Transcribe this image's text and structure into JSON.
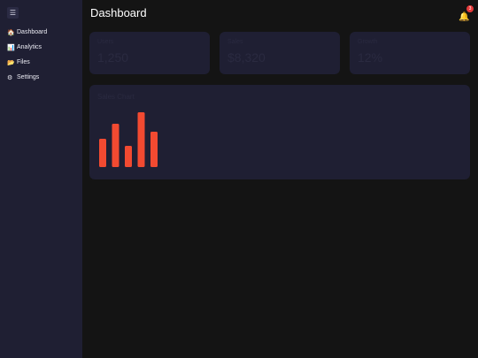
{
  "header": {
    "title": "Dashboard"
  },
  "sidebar": {
    "menu_icon": "hamburger-icon",
    "items": [
      {
        "label": "Dashboard",
        "icon": "🏠"
      },
      {
        "label": "Analytics",
        "icon": "📊"
      },
      {
        "label": "Files",
        "icon": "📂"
      },
      {
        "label": "Settings",
        "icon": "⚙"
      }
    ]
  },
  "notifications": {
    "icon": "bell-icon",
    "badge": "3"
  },
  "stats": [
    {
      "label": "Users",
      "value": "1,250"
    },
    {
      "label": "Sales",
      "value": "$8,320"
    },
    {
      "label": "Growth",
      "value": "12%"
    }
  ],
  "chart_data": {
    "type": "bar",
    "title": "Sales Chart",
    "values": [
      32,
      49,
      24,
      62,
      40
    ],
    "color": "#f24a31"
  },
  "colors": {
    "background": "#141414",
    "surface": "#1f1f33",
    "accent": "#f24a31",
    "badge": "#e63a3a"
  }
}
